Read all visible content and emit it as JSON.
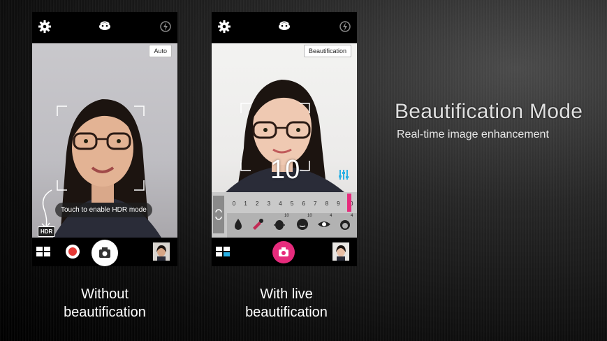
{
  "headline": "Beautification Mode",
  "subheadline": "Real-time image enhancement",
  "left_phone": {
    "mode_label": "Auto",
    "hint_text": "Touch to enable HDR mode",
    "hdr_badge": "HDR",
    "caption_line1": "Without",
    "caption_line2": "beautification",
    "icons": [
      "gear-icon",
      "beauty-mode-icon",
      "flash-icon",
      "grid-menu-icon",
      "record-icon",
      "camera-shutter-icon",
      "gallery-thumbnail"
    ]
  },
  "right_phone": {
    "mode_label": "Beautification",
    "level_overlay": "10",
    "slider_ticks": [
      "0",
      "1",
      "2",
      "3",
      "4",
      "5",
      "6",
      "7",
      "8",
      "9",
      "10"
    ],
    "slider_value": 10,
    "feature_values": [
      "10",
      "10",
      "4",
      "4"
    ],
    "caption_line1": "With live",
    "caption_line2": "beautification",
    "accent_color": "#e62b7c",
    "icons": [
      "gear-icon",
      "beauty-mode-icon",
      "flash-icon",
      "grid-menu-icon",
      "camera-shutter-icon",
      "gallery-thumbnail",
      "sliders-icon",
      "refresh-icon",
      "skin-tone-icon",
      "blush-icon",
      "face-slim-icon",
      "skin-smooth-icon",
      "eye-enlarge-icon",
      "hair-icon"
    ]
  }
}
